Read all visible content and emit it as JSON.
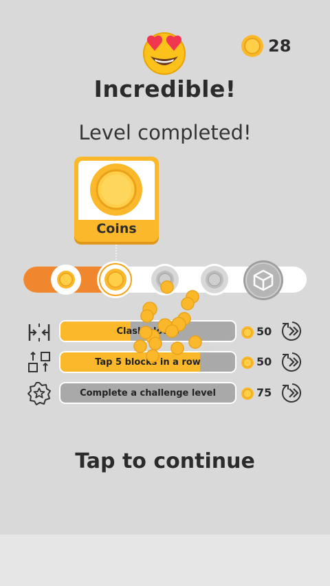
{
  "header": {
    "emoji": "heart-eyes-emoji",
    "coin_icon": "coin-icon",
    "coins": "28"
  },
  "result": {
    "title": "Incredible!",
    "subtitle": "Level completed!"
  },
  "reward_card": {
    "icon": "coin-icon",
    "label": "Coins"
  },
  "progress": {
    "fraction_filled": 0.33,
    "nodes": [
      {
        "icon": "coin-icon",
        "state": "collected"
      },
      {
        "icon": "coin-icon",
        "state": "current"
      },
      {
        "icon": "silver-coin-icon",
        "state": "locked"
      },
      {
        "icon": "silver-coin-icon",
        "state": "locked"
      },
      {
        "icon": "cube-icon",
        "state": "locked"
      }
    ]
  },
  "challenges": [
    {
      "icon": "clash-icon",
      "label": "Clash blocks",
      "progress": 0.4,
      "reward": "50",
      "action_icon": "skip-video-icon"
    },
    {
      "icon": "blocks-row-icon",
      "label": "Tap 5 blocks in a row",
      "progress": 0.8,
      "reward": "50",
      "action_icon": "skip-video-icon"
    },
    {
      "icon": "star-badge-icon",
      "label": "Complete a challenge level",
      "progress": 0.0,
      "reward": "75",
      "action_icon": "skip-video-icon"
    }
  ],
  "footer": {
    "cta": "Tap to continue"
  },
  "colors": {
    "accent": "#fbb82b",
    "progress_fill": "#f0872f",
    "background": "#d9d9d9",
    "bar_empty": "#a9a9a9"
  }
}
